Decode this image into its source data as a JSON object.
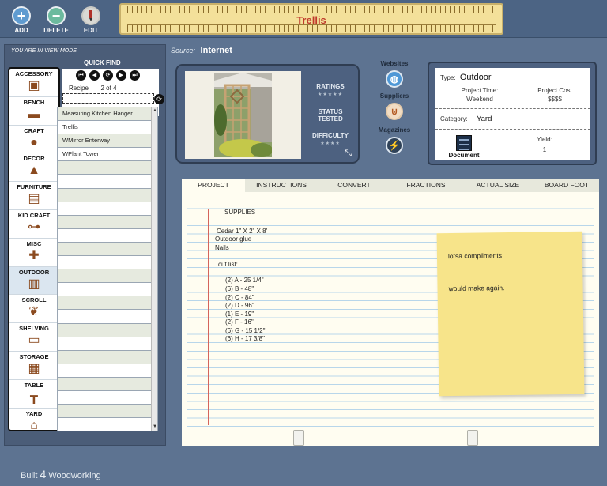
{
  "toolbar": {
    "add_label": "ADD",
    "delete_label": "DELETE",
    "edit_label": "EDIT",
    "add_icon": "plus-icon",
    "delete_icon": "minus-icon",
    "edit_icon": "pencil-icon"
  },
  "title": "Trellis",
  "left_panel": {
    "mode_text": "YOU ARE IN VIEW MODE",
    "quick_find_label": "QUICK FIND",
    "categories": [
      {
        "label": "ACCESSORY",
        "icon": "accessory-icon"
      },
      {
        "label": "BENCH",
        "icon": "bench-icon"
      },
      {
        "label": "CRAFT",
        "icon": "craft-icon"
      },
      {
        "label": "DECOR",
        "icon": "decor-icon"
      },
      {
        "label": "FURNITURE",
        "icon": "furniture-icon"
      },
      {
        "label": "KID CRAFT",
        "icon": "kid-craft-icon"
      },
      {
        "label": "MISC",
        "icon": "misc-icon"
      },
      {
        "label": "OUTDOOR",
        "icon": "outdoor-icon"
      },
      {
        "label": "SCROLL",
        "icon": "scroll-icon"
      },
      {
        "label": "SHELVING",
        "icon": "shelving-icon"
      },
      {
        "label": "STORAGE",
        "icon": "storage-icon"
      },
      {
        "label": "TABLE",
        "icon": "table-icon"
      },
      {
        "label": "YARD",
        "icon": "yard-icon"
      }
    ],
    "recipe_label": "Recipe",
    "recipe_current": "2",
    "recipe_of": "of",
    "recipe_total": "4",
    "nav_icons": [
      "first-icon",
      "prev-icon",
      "refresh-icon",
      "next-icon",
      "last-icon"
    ],
    "recipes": [
      "Measuring Kitchen Hanger",
      "Trellis",
      "WMirror Enterway",
      "WPlant Tower"
    ]
  },
  "source": {
    "label": "Source:",
    "value": "Internet"
  },
  "photo_card": {
    "ratings_label": "RATINGS",
    "status_label": "STATUS",
    "status_value": "TESTED",
    "difficulty_label": "DIFFICULTY",
    "ratings_stars": "★★★★★",
    "difficulty_stars": "★★★★"
  },
  "links": {
    "websites_label": "Websites",
    "suppliers_label": "Suppliers",
    "magazines_label": "Magazines"
  },
  "info": {
    "type_label": "Type:",
    "type_value": "Outdoor",
    "project_time_label": "Project Time:",
    "project_time_value": "Weekend",
    "project_cost_label": "Project Cost",
    "project_cost_value": "$$$$",
    "category_label": "Category:",
    "category_value": "Yard",
    "document_label": "Document",
    "yield_label": "Yield:",
    "yield_value": "1"
  },
  "tabs": [
    "PROJECT",
    "INSTRUCTIONS",
    "CONVERT",
    "FRACTIONS",
    "ACTUAL SIZE",
    "BOARD FOOT"
  ],
  "notebook": {
    "supplies_heading": "SUPPLIES",
    "supplies": [
      "Cedar 1\" X 2\" X 8'",
      "Outdoor glue",
      "Nails"
    ],
    "cut_list_heading": "cut list:",
    "cut_list": [
      "(2) A - 25 1/4\"",
      "(6) B - 48\"",
      "(2) C - 84\"",
      "(2) D - 96\"",
      "(1) E - 19\"",
      "(2) F - 16\"",
      "(6) G - 15 1/2\"",
      "(6) H - 17 3/8\""
    ],
    "sticky_note_line1": "lotsa compliments",
    "sticky_note_line2": "would make again."
  },
  "footer": {
    "brand_prefix": "Built",
    "brand_num": "4",
    "brand_suffix": "Woodworking"
  },
  "colors": {
    "title_red": "#c0392b",
    "accent_blue": "#4d6180",
    "sticky": "#f7e48a"
  }
}
